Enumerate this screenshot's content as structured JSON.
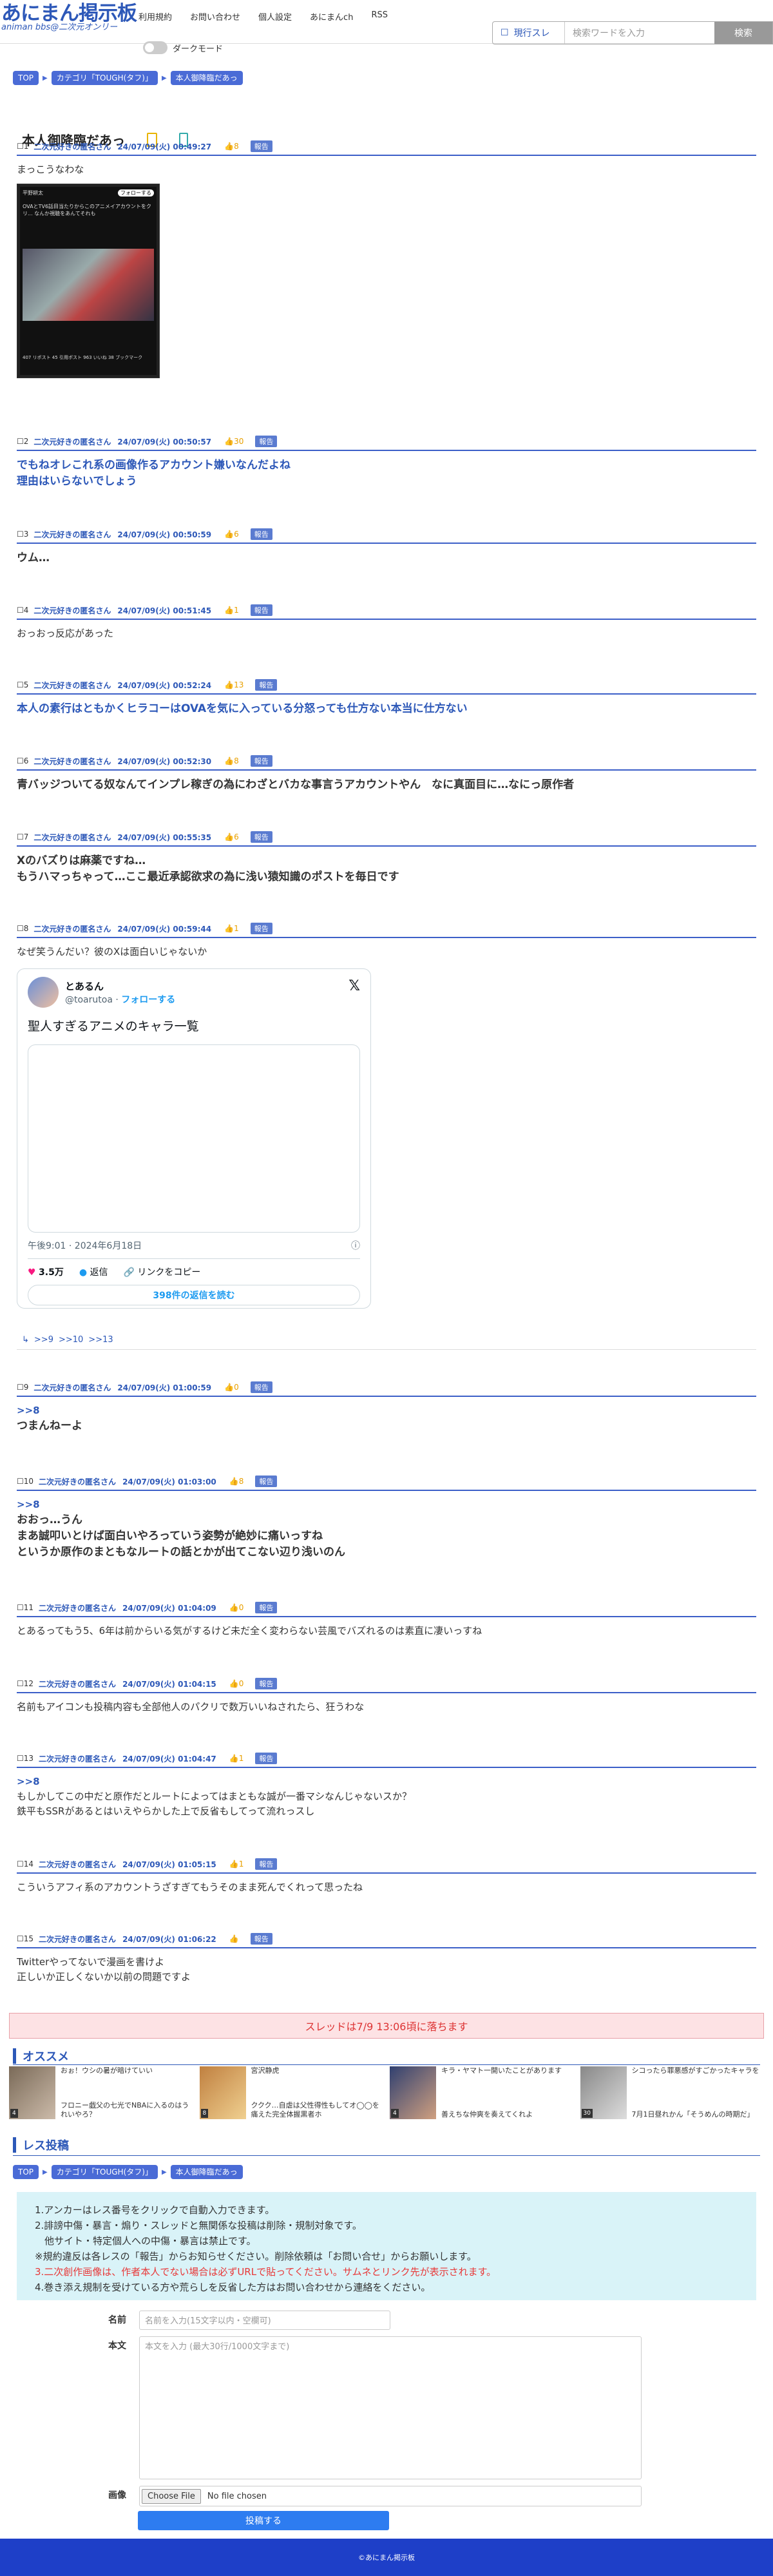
{
  "header": {
    "logo_main": "あにまん掲示板",
    "logo_sub": "animan bbs@二次元オンリー",
    "nav": [
      "利用規約",
      "お問い合わせ",
      "個人設定",
      "あにまんch",
      "RSS"
    ],
    "dark_mode_label": "ダークモード",
    "search_scope": "現行スレ",
    "search_placeholder": "検索ワードを入力",
    "search_button": "検索"
  },
  "breadcrumbs": [
    "TOP",
    "カテゴリ「TOUGH(タフ)」",
    "本人御降臨だあっ"
  ],
  "thread_title": "本人御降臨だあっ",
  "posts": [
    {
      "no": "1",
      "name": "二次元好きの匿名さん",
      "date": "24/07/09(火) 00:49:27",
      "good": "8",
      "report": "報告",
      "lines": [
        "まっこうなわな"
      ]
    },
    {
      "no": "2",
      "name": "二次元好きの匿名さん",
      "date": "24/07/09(火) 00:50:57",
      "good": "30",
      "report": "報告",
      "lines": [
        "でもねオレこれ系の画像作るアカウント嫌いなんだよね",
        "理由はいらないでしょう"
      ]
    },
    {
      "no": "3",
      "name": "二次元好きの匿名さん",
      "date": "24/07/09(火) 00:50:59",
      "good": "6",
      "report": "報告",
      "lines": [
        "ウム…"
      ]
    },
    {
      "no": "4",
      "name": "二次元好きの匿名さん",
      "date": "24/07/09(火) 00:51:45",
      "good": "1",
      "report": "報告",
      "lines": [
        "おっおっ反応があった"
      ]
    },
    {
      "no": "5",
      "name": "二次元好きの匿名さん",
      "date": "24/07/09(火) 00:52:24",
      "good": "13",
      "report": "報告",
      "lines": [
        "本人の素行はともかくヒラコーはOVAを気に入っている分怒っても仕方ない本当に仕方ない"
      ]
    },
    {
      "no": "6",
      "name": "二次元好きの匿名さん",
      "date": "24/07/09(火) 00:52:30",
      "good": "8",
      "report": "報告",
      "lines": [
        "青バッジついてる奴なんてインプレ稼ぎの為にわざとバカな事言うアカウントやん　なに真面目に…なにっ原作者"
      ]
    },
    {
      "no": "7",
      "name": "二次元好きの匿名さん",
      "date": "24/07/09(火) 00:55:35",
      "good": "6",
      "report": "報告",
      "lines": [
        "Xのバズりは麻薬ですね…",
        "もうハマっちゃって…ここ最近承認欲求の為に浅い猿知識のポストを毎日です"
      ]
    },
    {
      "no": "8",
      "name": "二次元好きの匿名さん",
      "date": "24/07/09(火) 00:59:44",
      "good": "1",
      "report": "報告",
      "lines": [
        "なぜ笑うんだい？彼のXは面白いじゃないか"
      ]
    },
    {
      "no": "9",
      "name": "二次元好きの匿名さん",
      "date": "24/07/09(火) 01:00:59",
      "good": "0",
      "report": "報告",
      "lines": [
        ">>8",
        "つまんねーよ"
      ]
    },
    {
      "no": "10",
      "name": "二次元好きの匿名さん",
      "date": "24/07/09(火) 01:03:00",
      "good": "8",
      "report": "報告",
      "lines": [
        ">>8",
        "おおっ…うん",
        "まあ誠叩いとけば面白いやろっていう姿勢が絶妙に痛いっすね",
        "というか原作のまともなルートの話とかが出てこない辺り浅いのん"
      ]
    },
    {
      "no": "11",
      "name": "二次元好きの匿名さん",
      "date": "24/07/09(火) 01:04:09",
      "good": "0",
      "report": "報告",
      "lines": [
        "とあるってもう5、6年は前からいる気がするけど未だ全く変わらない芸風でバズれるのは素直に凄いっすね"
      ]
    },
    {
      "no": "12",
      "name": "二次元好きの匿名さん",
      "date": "24/07/09(火) 01:04:15",
      "good": "0",
      "report": "報告",
      "lines": [
        "名前もアイコンも投稿内容も全部他人のパクリで数万いいねされたら、狂うわな"
      ]
    },
    {
      "no": "13",
      "name": "二次元好きの匿名さん",
      "date": "24/07/09(火) 01:04:47",
      "good": "1",
      "report": "報告",
      "lines": [
        ">>8",
        "もしかしてこの中だと原作だとルートによってはまともな誠が一番マシなんじゃないスか？",
        "鉄平もSSRがあるとはいえやらかした上で反省もしてって流れっスし"
      ]
    },
    {
      "no": "14",
      "name": "二次元好きの匿名さん",
      "date": "24/07/09(火) 01:05:15",
      "good": "1",
      "report": "報告",
      "lines": [
        "こういうアフィ系のアカウントうざすぎてもうそのまま死んでくれって思ったね"
      ]
    },
    {
      "no": "15",
      "name": "二次元好きの匿名さん",
      "date": "24/07/09(火) 01:06:22",
      "good": "",
      "report": "報告",
      "lines": [
        "Twitterやってないで漫画を書けよ",
        "正しいか正しくないか以前の問題ですよ"
      ]
    }
  ],
  "image_card": {
    "account": "平野耕太",
    "follow": "フォローする",
    "text": "OVAとTV6話目当たりからこのアニメイアカウントをクリ... なんか視聴をあんてそれも",
    "counts": "407 リポスト  45 引用ポスト  963 いいね  38 ブックマーク"
  },
  "tweet": {
    "name": "とあるん",
    "handle": "@toarutoa",
    "follow": "フォローする",
    "text": "聖人すぎるアニメのキャラ一覧",
    "time": "午後9:01 · 2024年6月18日",
    "likes": "3.5万",
    "reply": "返信",
    "copy": "リンクをコピー",
    "read_replies": "398件の返信を読む",
    "x_logo": "𝕏"
  },
  "reply_links": [
    ">>9",
    ">>10",
    ">>13"
  ],
  "fall_notice": "スレッドは7/9 13:06頃に落ちます",
  "recommend": {
    "title": "オススメ",
    "items": [
      {
        "a": "おぉ！ウシの暑が暗けていい",
        "b": "フロニー戯父の七光でNBAに入るのはうれいやろ？",
        "c1": "#7a6a58",
        "c2": "#cba",
        "badge": "4"
      },
      {
        "a": "宮沢静虎",
        "b": "ククク…自虐は父性得性もしてオ◯◯を痛えた完全体握黒者ホ",
        "c1": "#c08040",
        "c2": "#f0d090",
        "badge": "8"
      },
      {
        "a": "キラ・ヤマト一開いたことがあります",
        "b": "善えちな仲爽を奏えてくれよ",
        "c1": "#304070",
        "c2": "#d0a080",
        "badge": "4"
      },
      {
        "a": "シコったら罪悪感がすごかったキャラを",
        "b": "7月1日昼れかん「そうめんの時期だ」",
        "c1": "#888",
        "c2": "#ddd",
        "badge": "30"
      }
    ]
  },
  "reply_form": {
    "title": "レス投稿",
    "rules": [
      "1.アンカーはレス番号をクリックで自動入力できます。",
      "2.誹謗中傷・暴言・煽り・スレッドと無関係な投稿は削除・規制対象です。",
      "　他サイト・特定個人への中傷・暴言は禁止です。",
      "※規約違反は各レスの「報告」からお知らせください。削除依頼は「お問い合せ」からお願いします。",
      "3.二次創作画像は、作者本人でない場合は必ずURLで貼ってください。サムネとリンク先が表示されます。",
      "4.巻き添え規制を受けている方や荒らしを反省した方はお問い合わせから連絡をください。"
    ],
    "name_label": "名前",
    "name_placeholder": "名前を入力(15文字以内・空欄可)",
    "body_label": "本文",
    "body_placeholder": "本文を入力 (最大30行/1000文字まで)",
    "image_label": "画像",
    "file_button": "Choose File",
    "file_status": "No file chosen",
    "submit": "投稿する"
  },
  "footer": "©あにまん掲示板"
}
